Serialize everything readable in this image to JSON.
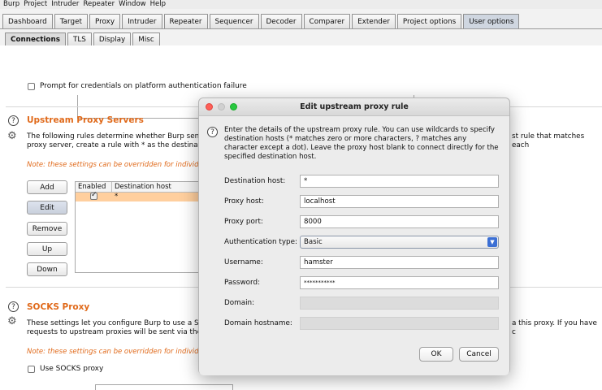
{
  "menubar": [
    "Burp",
    "Project",
    "Intruder",
    "Repeater",
    "Window",
    "Help"
  ],
  "main_tabs": [
    "Dashboard",
    "Target",
    "Proxy",
    "Intruder",
    "Repeater",
    "Sequencer",
    "Decoder",
    "Comparer",
    "Extender",
    "Project options",
    "User options"
  ],
  "sub_tabs": [
    "Connections",
    "TLS",
    "Display",
    "Misc"
  ],
  "platform_auth": {
    "label": "Prompt for credentials on platform authentication failure"
  },
  "upstream": {
    "title": "Upstream Proxy Servers",
    "desc_line1": "The following rules determine whether Burp send",
    "desc_line2": "proxy server, create a rule with * as the destinatio",
    "desc_right": "st rule that matches each",
    "note": "Note: these settings can be overridden for individ",
    "buttons": {
      "add": "Add",
      "edit": "Edit",
      "remove": "Remove",
      "up": "Up",
      "down": "Down"
    },
    "table": {
      "headers": [
        "Enabled",
        "Destination host"
      ],
      "rows": [
        {
          "host": "*"
        }
      ]
    }
  },
  "socks": {
    "title": "SOCKS Proxy",
    "desc_line1": "These settings let you configure Burp to use a SO",
    "desc_line2": "requests to upstream proxies will be sent via the",
    "desc_right": "a this proxy. If you have c",
    "note": "Note: these settings can be overridden for individ",
    "use_label": "Use SOCKS proxy"
  },
  "dialog": {
    "title": "Edit upstream proxy rule",
    "intro": "Enter the details of the upstream proxy rule. You can use wildcards to specify destination hosts (* matches zero or more characters, ? matches any character except a dot). Leave the proxy host blank to connect directly for the specified destination host.",
    "labels": {
      "dest_host": "Destination host:",
      "proxy_host": "Proxy host:",
      "proxy_port": "Proxy port:",
      "auth_type": "Authentication type:",
      "username": "Username:",
      "password": "Password:",
      "domain": "Domain:",
      "domain_hostname": "Domain hostname:"
    },
    "values": {
      "dest_host": "*",
      "proxy_host": "localhost",
      "proxy_port": "8000",
      "auth_type": "Basic",
      "username": "hamster",
      "password": "***********",
      "domain": "",
      "domain_hostname": ""
    },
    "ok": "OK",
    "cancel": "Cancel"
  },
  "colors": {
    "accent_orange": "#e06a1b",
    "selected_row": "#ffcf9e",
    "select_arrow": "#3b6fd4"
  }
}
